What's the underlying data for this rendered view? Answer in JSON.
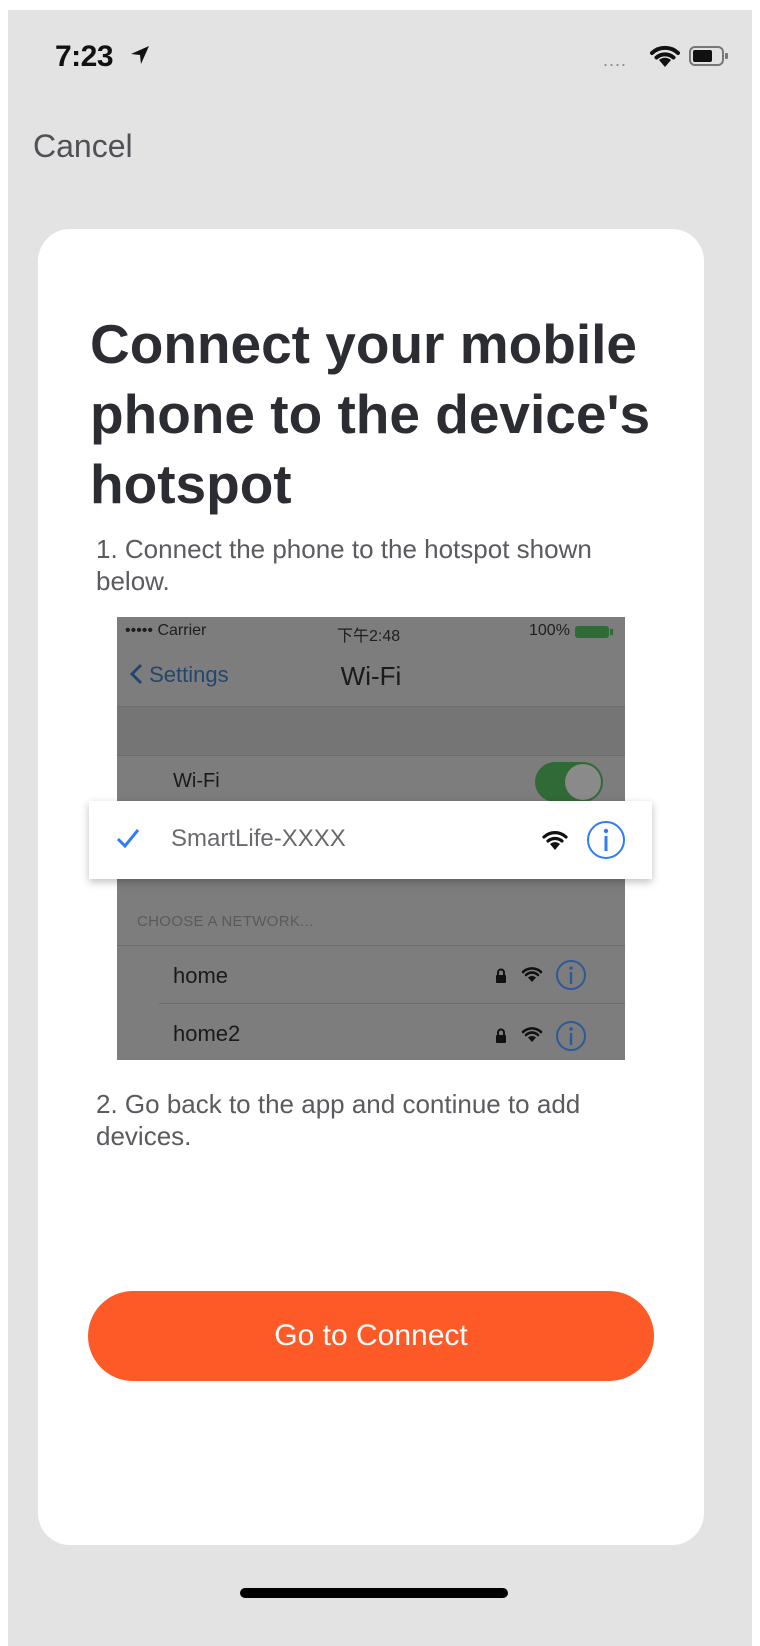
{
  "status_bar": {
    "time": "7:23",
    "signal": "....",
    "icons": [
      "location-arrow-icon",
      "wifi-icon",
      "battery-icon"
    ]
  },
  "nav": {
    "cancel_label": "Cancel"
  },
  "card": {
    "title": "Connect your mobile phone to the device's hotspot",
    "step1": "1. Connect the phone to the hotspot shown below.",
    "step2": "2. Go back to the app and continue to add devices.",
    "button_label": "Go to Connect"
  },
  "illustration": {
    "status": {
      "carrier": "••••• Carrier",
      "time": "下午2:48",
      "battery": "100%"
    },
    "back_label": "Settings",
    "nav_title": "Wi-Fi",
    "wifi_label": "Wi-Fi",
    "wifi_on": true,
    "selected_network": "SmartLife-XXXX",
    "section_header": "CHOOSE A NETWORK...",
    "networks": [
      "home",
      "home2"
    ]
  },
  "colors": {
    "accent": "#fe5a27",
    "ios_blue": "#2f7cf6",
    "background": "#e3e3e3",
    "card": "#ffffff"
  }
}
